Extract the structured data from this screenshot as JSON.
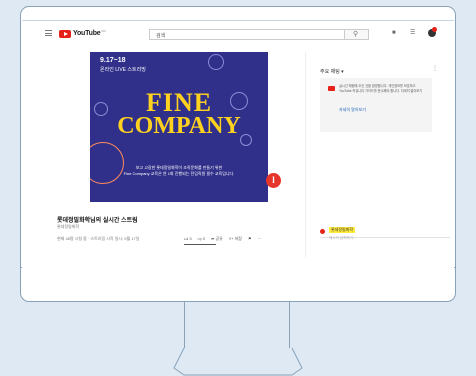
{
  "youtube": {
    "logo_word": "YouTube",
    "logo_sup": "KR",
    "search_text": "검색",
    "search_icon": "magnifier-icon"
  },
  "video": {
    "thumb_date": "9.17~18",
    "thumb_sub": "온라인 LIVE 스트리밍",
    "thumb_fine": "FINE",
    "thumb_company": "COMPANY",
    "thumb_desc1": "보고 고갈한 롯데정밀화학이 조직문화를 만들기 위한",
    "thumb_desc2": "Fine Company 교육은 연 1회 진행되는 전임직원 필수 교육입니다.",
    "badge_letter": "l",
    "title": "롯데정밀화학님의 실시간 스트림",
    "channel": "롯데정밀화학",
    "meta": "현재 48명 시청 중 · 스트리밍 시작 일시: 9월 17일",
    "likes": "3",
    "dislikes": "0",
    "share": "공유",
    "save": "저장",
    "like_ratio": 1.0
  },
  "sidebar": {
    "heading": "주요 채팅 ▾",
    "notice": "실시간 채팅에 오신 것을 환영합니다. 개인정보를 보호하고 YouTube 커뮤니티 가이드를 준수해야 합니다. 자세히 알아보기",
    "link": "자세히 알아보기",
    "chat_user": "롯데정밀화학",
    "chat_placeholder": "메시지 입력하기..."
  },
  "colors": {
    "youtube_red": "#e62117",
    "thumb_bg": "#30308a",
    "thumb_title": "#ffd21f",
    "monitor_outline": "#8aa2b8",
    "page_bg": "#dfe9f3"
  }
}
